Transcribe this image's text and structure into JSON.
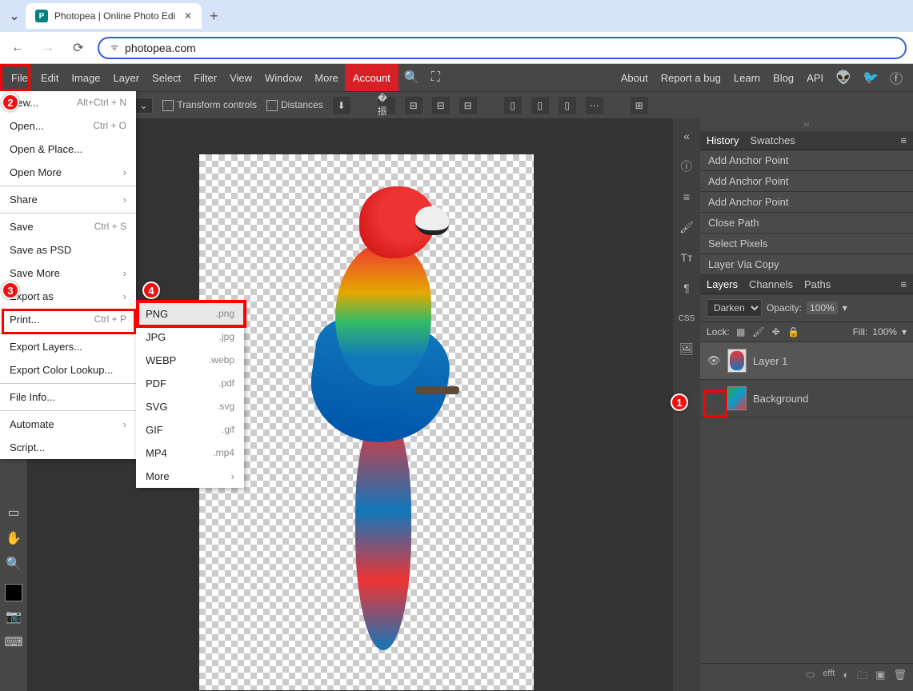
{
  "browser": {
    "tab_title": "Photopea | Online Photo Edi",
    "url": "photopea.com"
  },
  "menu": {
    "items": [
      "File",
      "Edit",
      "Image",
      "Layer",
      "Select",
      "Filter",
      "View",
      "Window",
      "More"
    ],
    "account": "Account",
    "right_links": [
      "About",
      "Report a bug",
      "Learn",
      "Blog",
      "API"
    ]
  },
  "toolbar": {
    "transform": "Transform controls",
    "distances": "Distances"
  },
  "file_menu": [
    {
      "label": "New...",
      "kb": "Alt+Ctrl + N"
    },
    {
      "label": "Open...",
      "kb": "Ctrl + O"
    },
    {
      "label": "Open & Place..."
    },
    {
      "label": "Open More",
      "sub": true
    },
    {
      "sep": true
    },
    {
      "label": "Share",
      "sub": true
    },
    {
      "sep": true
    },
    {
      "label": "Save",
      "kb": "Ctrl + S"
    },
    {
      "label": "Save as PSD"
    },
    {
      "label": "Save More",
      "sub": true
    },
    {
      "label": "Export as",
      "sub": true
    },
    {
      "label": "Print...",
      "kb": "Ctrl + P"
    },
    {
      "sep": true
    },
    {
      "label": "Export Layers..."
    },
    {
      "label": "Export Color Lookup..."
    },
    {
      "sep": true
    },
    {
      "label": "File Info..."
    },
    {
      "sep": true
    },
    {
      "label": "Automate",
      "sub": true
    },
    {
      "label": "Script..."
    }
  ],
  "export_sub": [
    {
      "label": "PNG",
      "ext": ".png"
    },
    {
      "label": "JPG",
      "ext": ".jpg"
    },
    {
      "label": "WEBP",
      "ext": ".webp"
    },
    {
      "label": "PDF",
      "ext": ".pdf"
    },
    {
      "label": "SVG",
      "ext": ".svg"
    },
    {
      "label": "GIF",
      "ext": ".gif"
    },
    {
      "label": "MP4",
      "ext": ".mp4"
    },
    {
      "label": "More",
      "sub": true
    }
  ],
  "panels": {
    "history": {
      "tabs": [
        "History",
        "Swatches"
      ],
      "items": [
        "Add Anchor Point",
        "Add Anchor Point",
        "Add Anchor Point",
        "Close Path",
        "Select Pixels",
        "Layer Via Copy"
      ]
    },
    "layers": {
      "tabs": [
        "Layers",
        "Channels",
        "Paths"
      ],
      "blend": "Darken",
      "opacity_label": "Opacity:",
      "opacity": "100%",
      "lock_label": "Lock:",
      "fill_label": "Fill:",
      "fill": "100%",
      "items": [
        {
          "name": "Layer 1",
          "visible": true
        },
        {
          "name": "Background",
          "visible": false
        }
      ]
    }
  },
  "annotations": {
    "1": "1",
    "2": "2",
    "3": "3",
    "4": "4"
  }
}
